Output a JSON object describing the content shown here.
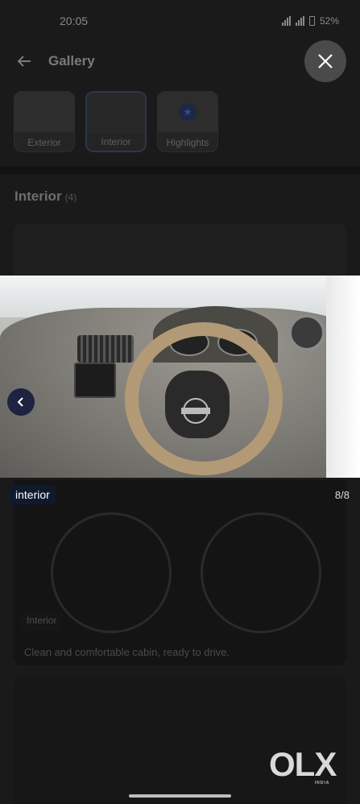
{
  "status_bar": {
    "time": "20:05",
    "battery": "52%"
  },
  "header": {
    "title": "Gallery"
  },
  "chips": [
    {
      "label": "Exterior"
    },
    {
      "label": "Interior"
    },
    {
      "label": "Highlights"
    }
  ],
  "section": {
    "title": "Interior",
    "count": "(4)"
  },
  "viewer": {
    "tag": "interior",
    "counter": "8/8"
  },
  "background_card": {
    "tag": "Interior",
    "caption": "Clean and comfortable cabin, ready to drive."
  },
  "brand": {
    "logo": "OLX",
    "sub": "INDIA"
  }
}
